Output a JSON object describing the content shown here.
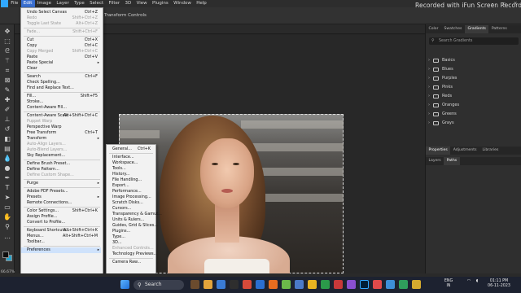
{
  "app": {
    "watermark": "Recorded with iFun Screen Recorder",
    "menus": [
      "File",
      "Edit",
      "Image",
      "Layer",
      "Type",
      "Select",
      "Filter",
      "3D",
      "View",
      "Plugins",
      "Window",
      "Help"
    ],
    "active_menu": "Edit",
    "options_bar_text": "Transform Controls",
    "zoom_status": "66.67%"
  },
  "edit_menu": {
    "items": [
      {
        "label": "Undo Select Canvas",
        "shortcut": "Ctrl+Z",
        "disabled": false
      },
      {
        "label": "Redo",
        "shortcut": "Shift+Ctrl+Z",
        "disabled": true
      },
      {
        "label": "Toggle Last State",
        "shortcut": "Alt+Ctrl+Z",
        "disabled": true
      },
      {
        "sep": true
      },
      {
        "label": "Fade...",
        "shortcut": "Shift+Ctrl+F",
        "disabled": true
      },
      {
        "sep": true
      },
      {
        "label": "Cut",
        "shortcut": "Ctrl+X",
        "disabled": false
      },
      {
        "label": "Copy",
        "shortcut": "Ctrl+C",
        "disabled": false
      },
      {
        "label": "Copy Merged",
        "shortcut": "Shift+Ctrl+C",
        "disabled": true
      },
      {
        "label": "Paste",
        "shortcut": "Ctrl+V",
        "disabled": false
      },
      {
        "label": "Paste Special",
        "shortcut": "",
        "disabled": false,
        "submenu": true
      },
      {
        "label": "Clear",
        "shortcut": "",
        "disabled": false
      },
      {
        "sep": true
      },
      {
        "label": "Search",
        "shortcut": "Ctrl+F",
        "disabled": false
      },
      {
        "label": "Check Spelling...",
        "shortcut": "",
        "disabled": false
      },
      {
        "label": "Find and Replace Text...",
        "shortcut": "",
        "disabled": false
      },
      {
        "sep": true
      },
      {
        "label": "Fill...",
        "shortcut": "Shift+F5",
        "disabled": false
      },
      {
        "label": "Stroke...",
        "shortcut": "",
        "disabled": false
      },
      {
        "label": "Content-Aware Fill...",
        "shortcut": "",
        "disabled": false
      },
      {
        "sep": true
      },
      {
        "label": "Content-Aware Scale",
        "shortcut": "Alt+Shift+Ctrl+C",
        "disabled": false
      },
      {
        "label": "Puppet Warp",
        "shortcut": "",
        "disabled": true
      },
      {
        "label": "Perspective Warp",
        "shortcut": "",
        "disabled": false
      },
      {
        "label": "Free Transform",
        "shortcut": "Ctrl+T",
        "disabled": false
      },
      {
        "label": "Transform",
        "shortcut": "",
        "disabled": false,
        "submenu": true
      },
      {
        "label": "Auto-Align Layers...",
        "shortcut": "",
        "disabled": true
      },
      {
        "label": "Auto-Blend Layers...",
        "shortcut": "",
        "disabled": true
      },
      {
        "label": "Sky Replacement...",
        "shortcut": "",
        "disabled": false
      },
      {
        "sep": true
      },
      {
        "label": "Define Brush Preset...",
        "shortcut": "",
        "disabled": false
      },
      {
        "label": "Define Pattern...",
        "shortcut": "",
        "disabled": false
      },
      {
        "label": "Define Custom Shape...",
        "shortcut": "",
        "disabled": true
      },
      {
        "sep": true
      },
      {
        "label": "Purge",
        "shortcut": "",
        "disabled": false,
        "submenu": true
      },
      {
        "sep": true
      },
      {
        "label": "Adobe PDF Presets...",
        "shortcut": "",
        "disabled": false
      },
      {
        "label": "Presets",
        "shortcut": "",
        "disabled": false,
        "submenu": true
      },
      {
        "label": "Remote Connections...",
        "shortcut": "",
        "disabled": false
      },
      {
        "sep": true
      },
      {
        "label": "Color Settings...",
        "shortcut": "Shift+Ctrl+K",
        "disabled": false
      },
      {
        "label": "Assign Profile...",
        "shortcut": "",
        "disabled": false
      },
      {
        "label": "Convert to Profile...",
        "shortcut": "",
        "disabled": false
      },
      {
        "sep": true
      },
      {
        "label": "Keyboard Shortcuts...",
        "shortcut": "Alt+Shift+Ctrl+K",
        "disabled": false
      },
      {
        "label": "Menus...",
        "shortcut": "Alt+Shift+Ctrl+M",
        "disabled": false
      },
      {
        "label": "Toolbar...",
        "shortcut": "",
        "disabled": false
      },
      {
        "sep": true
      },
      {
        "label": "Preferences",
        "shortcut": "",
        "disabled": false,
        "submenu": true,
        "highlighted": true
      }
    ]
  },
  "prefs_menu": {
    "items": [
      {
        "label": "General...",
        "shortcut": "Ctrl+K",
        "disabled": false
      },
      {
        "sep": true
      },
      {
        "label": "Interface...",
        "shortcut": "",
        "disabled": false
      },
      {
        "label": "Workspace...",
        "shortcut": "",
        "disabled": false
      },
      {
        "label": "Tools...",
        "shortcut": "",
        "disabled": false
      },
      {
        "label": "History...",
        "shortcut": "",
        "disabled": false
      },
      {
        "label": "File Handling...",
        "shortcut": "",
        "disabled": false
      },
      {
        "label": "Export...",
        "shortcut": "",
        "disabled": false
      },
      {
        "label": "Performance...",
        "shortcut": "",
        "disabled": false
      },
      {
        "label": "Image Processing...",
        "shortcut": "",
        "disabled": false
      },
      {
        "label": "Scratch Disks...",
        "shortcut": "",
        "disabled": false
      },
      {
        "label": "Cursors...",
        "shortcut": "",
        "disabled": false
      },
      {
        "label": "Transparency & Gamut...",
        "shortcut": "",
        "disabled": false
      },
      {
        "label": "Units & Rulers...",
        "shortcut": "",
        "disabled": false
      },
      {
        "label": "Guides, Grid & Slices...",
        "shortcut": "",
        "disabled": false
      },
      {
        "label": "Plugins...",
        "shortcut": "",
        "disabled": false
      },
      {
        "label": "Type...",
        "shortcut": "",
        "disabled": false
      },
      {
        "label": "3D...",
        "shortcut": "",
        "disabled": false
      },
      {
        "label": "Enhanced Controls...",
        "shortcut": "",
        "disabled": true
      },
      {
        "label": "Technology Previews...",
        "shortcut": "",
        "disabled": false
      },
      {
        "sep": true
      },
      {
        "label": "Camera Raw...",
        "shortcut": "",
        "disabled": false
      }
    ]
  },
  "panels": {
    "top_tabs": [
      "Color",
      "Swatches",
      "Gradients",
      "Patterns"
    ],
    "active_top_tab": "Gradients",
    "search_placeholder": "Search Gradients",
    "folders": [
      "Basics",
      "Blues",
      "Purples",
      "Pinks",
      "Reds",
      "Oranges",
      "Greens",
      "Grays"
    ],
    "mid_tabs": [
      "Properties",
      "Adjustments",
      "Libraries"
    ],
    "bottom_tabs": [
      "Layers",
      "Paths"
    ]
  },
  "taskbar": {
    "search_label": "Search",
    "tray_lang": "ENG",
    "tray_region": "IN",
    "time": "01:11 PM",
    "date": "06-11-2023"
  }
}
